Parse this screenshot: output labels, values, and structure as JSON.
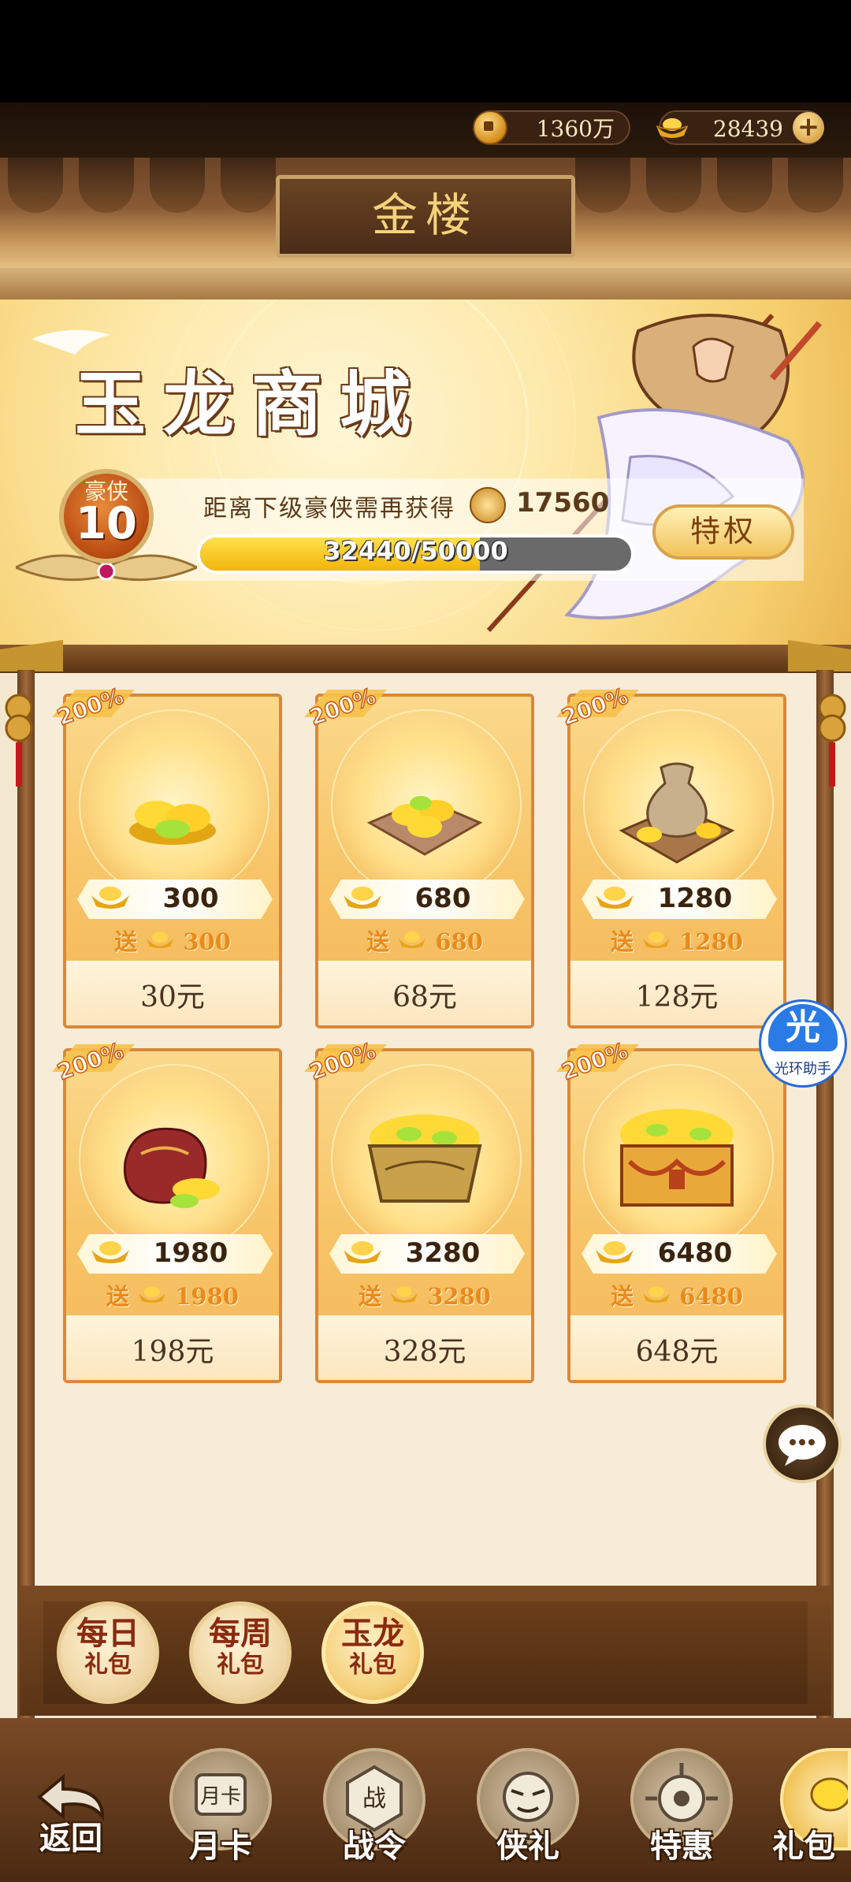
{
  "currency": {
    "coins": "1360万",
    "gold": "28439"
  },
  "header": {
    "title": "金楼"
  },
  "banner": {
    "title": "玉龙商城",
    "vip_label": "豪侠",
    "vip_level": "10",
    "need_text": "距离下级豪侠需再获得",
    "need_value": "17560",
    "progress_text": "32440/50000",
    "progress_fraction": 0.6488,
    "privilege_label": "特权"
  },
  "packs": [
    {
      "badge": "200%",
      "amount": "300",
      "bonus_prefix": "送",
      "bonus": "300",
      "price": "30元",
      "art": "gold-ingot-pile-icon"
    },
    {
      "badge": "200%",
      "amount": "680",
      "bonus_prefix": "送",
      "bonus": "680",
      "price": "68元",
      "art": "gold-ingot-tray-icon"
    },
    {
      "badge": "200%",
      "amount": "1280",
      "bonus_prefix": "送",
      "bonus": "1280",
      "price": "128元",
      "art": "gold-sack-tray-icon"
    },
    {
      "badge": "200%",
      "amount": "1980",
      "bonus_prefix": "送",
      "bonus": "1980",
      "price": "198元",
      "art": "gold-pouch-icon"
    },
    {
      "badge": "200%",
      "amount": "3280",
      "bonus_prefix": "送",
      "bonus": "3280",
      "price": "328元",
      "art": "gold-basket-icon"
    },
    {
      "badge": "200%",
      "amount": "6480",
      "bonus_prefix": "送",
      "bonus": "6480",
      "price": "648元",
      "art": "gold-chest-icon"
    }
  ],
  "tabs": [
    {
      "line1": "每日",
      "line2": "礼包",
      "active": false
    },
    {
      "line1": "每周",
      "line2": "礼包",
      "active": false
    },
    {
      "line1": "玉龙",
      "line2": "礼包",
      "active": true
    }
  ],
  "floating": {
    "helper_glyph": "光",
    "helper_label": "光环助手"
  },
  "bottom_nav": {
    "back": "返回",
    "items": [
      "月卡",
      "战令",
      "侠礼",
      "特惠",
      "礼包"
    ],
    "icon_text": [
      "月卡",
      "战"
    ]
  },
  "colors": {
    "accent_gold": "#f6c75a",
    "card_border": "#d9883a",
    "bonus_orange": "#e98a1c",
    "tab_text": "#8a2a10"
  }
}
